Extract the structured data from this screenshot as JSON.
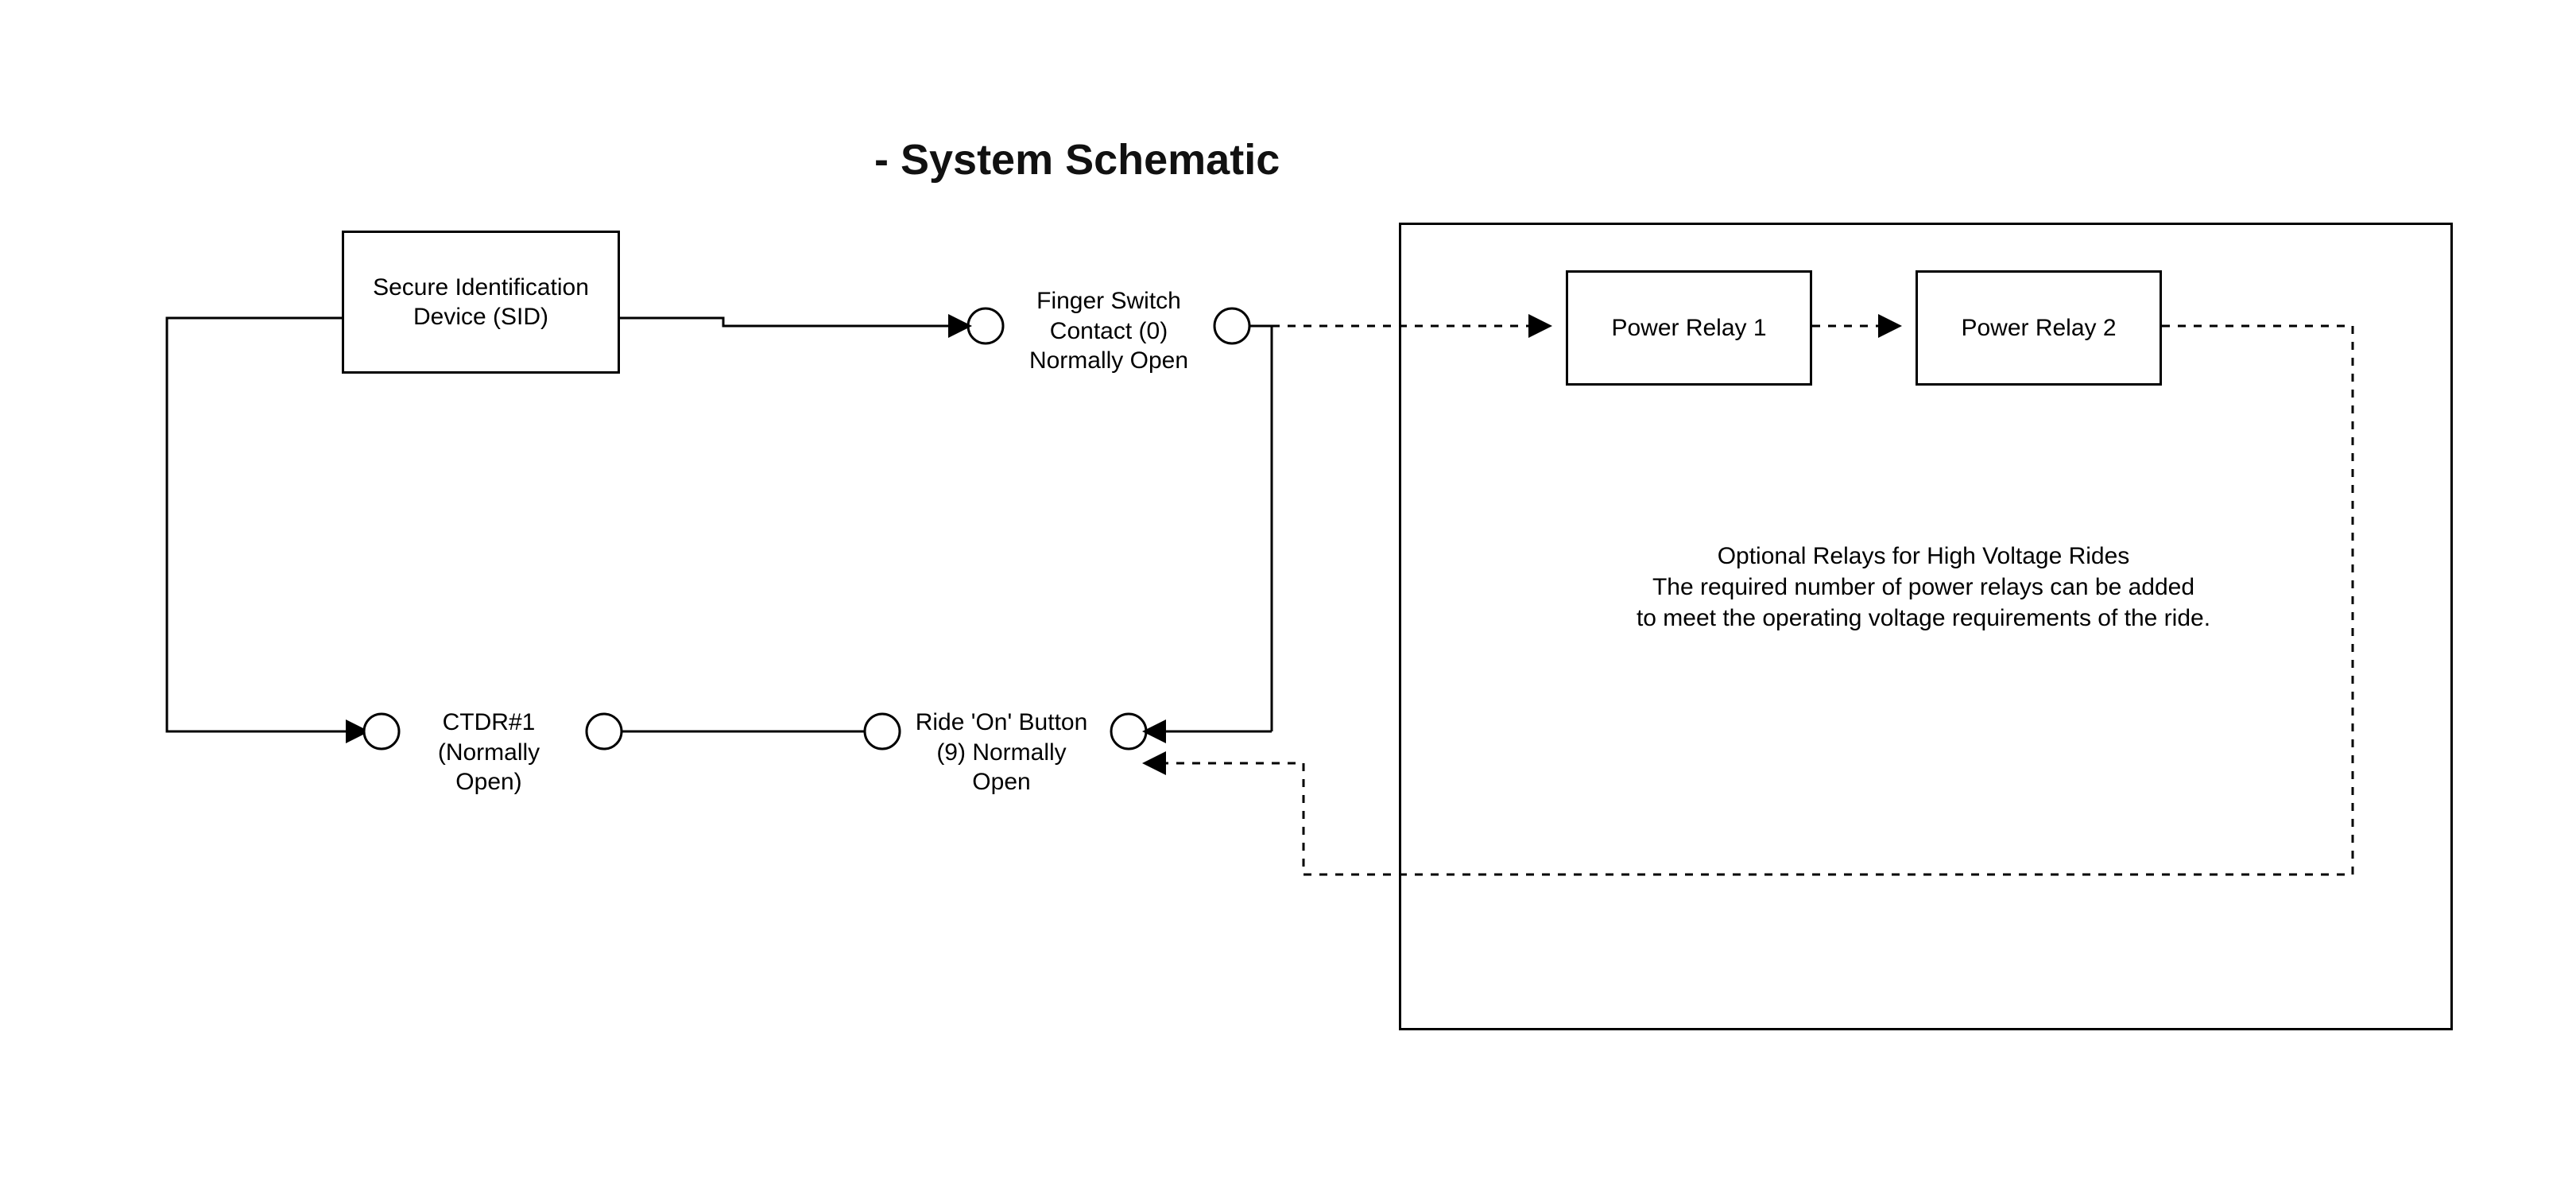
{
  "title": "- System Schematic",
  "blocks": {
    "sid": "Secure Identification Device (SID)",
    "relay1": "Power Relay 1",
    "relay2": "Power Relay 2"
  },
  "nodes": {
    "ctdr": "CTDR#1 (Normally Open)",
    "finger": "Finger Switch Contact (0) Normally Open",
    "ride": "Ride 'On' Button (9) Normally Open"
  },
  "note": {
    "line1": "Optional Relays for High Voltage Rides",
    "line2": "The required number of power relays can be added",
    "line3": "to meet the operating voltage requirements of the ride."
  }
}
